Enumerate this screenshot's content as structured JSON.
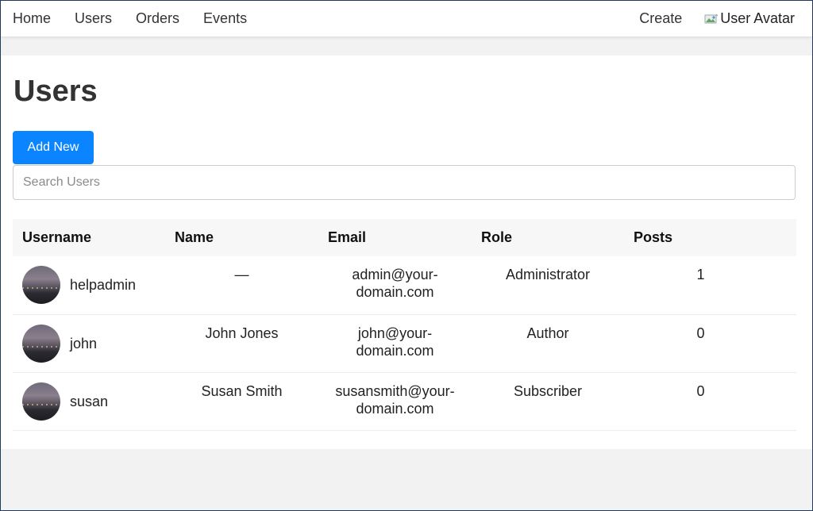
{
  "nav": {
    "links": [
      "Home",
      "Users",
      "Orders",
      "Events"
    ],
    "create_label": "Create",
    "avatar_alt": "User Avatar"
  },
  "page": {
    "title": "Users",
    "add_button_label": "Add New",
    "search_placeholder": "Search Users"
  },
  "table": {
    "headers": [
      "Username",
      "Name",
      "Email",
      "Role",
      "Posts"
    ],
    "rows": [
      {
        "username": "helpadmin",
        "name": "—",
        "email_line1": "admin@your-",
        "email_line2": "domain.com",
        "role": "Administrator",
        "posts": "1"
      },
      {
        "username": "john",
        "name": "John Jones",
        "email_line1": "john@your-",
        "email_line2": "domain.com",
        "role": "Author",
        "posts": "0"
      },
      {
        "username": "susan",
        "name": "Susan Smith",
        "email_line1": "susansmith@your-",
        "email_line2": "domain.com",
        "role": "Subscriber",
        "posts": "0"
      }
    ]
  },
  "colors": {
    "accent": "#0a84ff",
    "background": "#f2f2f2",
    "card": "#ffffff",
    "header_row": "#f7f7f7"
  },
  "icons": {
    "avatar_image": "broken-image-icon",
    "user_avatar": "user-photo"
  }
}
